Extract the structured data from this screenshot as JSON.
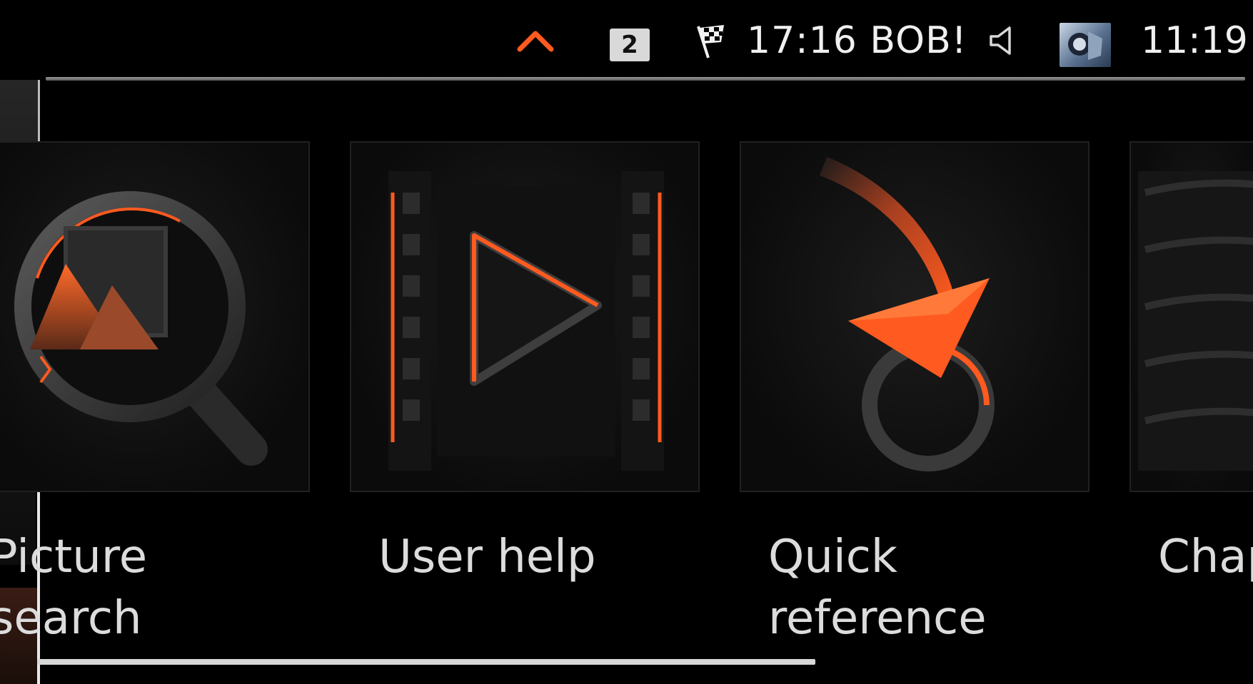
{
  "status_bar": {
    "badge": "2",
    "nav_text": "17:16 BOB!",
    "clock": "11:19",
    "icons": [
      "chevron-up-icon",
      "checkered-flag-icon",
      "speaker-icon",
      "media-thumbnail"
    ]
  },
  "tiles": [
    {
      "label": "Picture\nsearch",
      "icon": "magnifier-picture-icon"
    },
    {
      "label": "User help",
      "icon": "film-play-icon"
    },
    {
      "label": "Quick\nreference",
      "icon": "curved-arrow-icon"
    },
    {
      "label": "Chap",
      "icon": "book-pages-icon"
    }
  ],
  "colors": {
    "background": "#000000",
    "accent": "#ff5a1f",
    "text": "#dcdcdc"
  }
}
